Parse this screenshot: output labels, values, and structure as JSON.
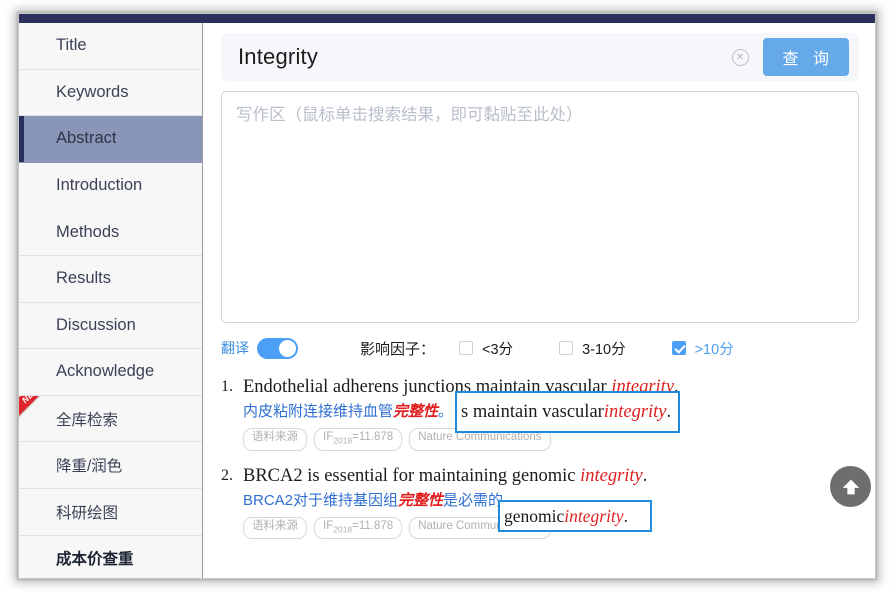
{
  "window": {
    "titlebar_color": "#2b2f5e",
    "accent_blue": "#4ba0f5",
    "highlight_red": "#e02020",
    "annotation_blue": "#1e8bdc",
    "active_item_bg": "#8a96b8"
  },
  "sidebar": {
    "items": [
      {
        "label": "Title",
        "active": false,
        "badge": ""
      },
      {
        "label": "Keywords",
        "active": false,
        "badge": ""
      },
      {
        "label": "Abstract",
        "active": true,
        "badge": ""
      },
      {
        "label": "Introduction",
        "active": false,
        "badge": ""
      },
      {
        "label": "Methods",
        "active": false,
        "badge": ""
      },
      {
        "label": "Results",
        "active": false,
        "badge": ""
      },
      {
        "label": "Discussion",
        "active": false,
        "badge": ""
      },
      {
        "label": "Acknowledge",
        "active": false,
        "badge": ""
      },
      {
        "label": "全库检索",
        "active": false,
        "badge": "NEW"
      },
      {
        "label": "降重/润色",
        "active": false,
        "badge": ""
      },
      {
        "label": "科研绘图",
        "active": false,
        "badge": ""
      },
      {
        "label": "成本价查重",
        "active": false,
        "badge": ""
      }
    ]
  },
  "search": {
    "value": "Integrity",
    "clear_icon": "close-circle-icon",
    "query_button": "查 询"
  },
  "writing_area": {
    "placeholder": "写作区（鼠标单击搜索结果，即可黏贴至此处）"
  },
  "filters": {
    "translate_label": "翻译",
    "translate_on": true,
    "impact_factor_label": "影响因子：",
    "checkboxes": [
      {
        "label": "<3分",
        "checked": false
      },
      {
        "label": "3-10分",
        "checked": false
      },
      {
        "label": ">10分",
        "checked": true
      }
    ]
  },
  "results": [
    {
      "number": "1.",
      "en_before": "Endothelial adherens junctions maintain vascular ",
      "en_highlight": "integrity",
      "en_after": ".",
      "cn_before": "内皮粘附连接维持血管",
      "cn_highlight": "完整性",
      "cn_after": "。",
      "tags": [
        {
          "text": "语料来源"
        },
        {
          "text": "IF",
          "sub": "2018",
          "suffix": "=11.878"
        },
        {
          "text": "Nature Communications"
        }
      ]
    },
    {
      "number": "2.",
      "en_before": "BRCA2 is essential for maintaining genomic ",
      "en_highlight": "integrity",
      "en_after": ".",
      "cn_before": "BRCA2对于维持基因组",
      "cn_highlight": "完整性",
      "cn_after": "是必需的。",
      "tags": [
        {
          "text": "语料来源"
        },
        {
          "text": "IF",
          "sub": "2018",
          "suffix": "=11.878"
        },
        {
          "text": "Nature Communications"
        }
      ]
    }
  ],
  "annotations": [
    {
      "before": "s maintain vascular ",
      "highlight": "integrity",
      "after": "."
    },
    {
      "before": "genomic ",
      "highlight": "integrity",
      "after": "."
    }
  ],
  "back_to_top": {
    "icon": "arrow-up-icon"
  }
}
